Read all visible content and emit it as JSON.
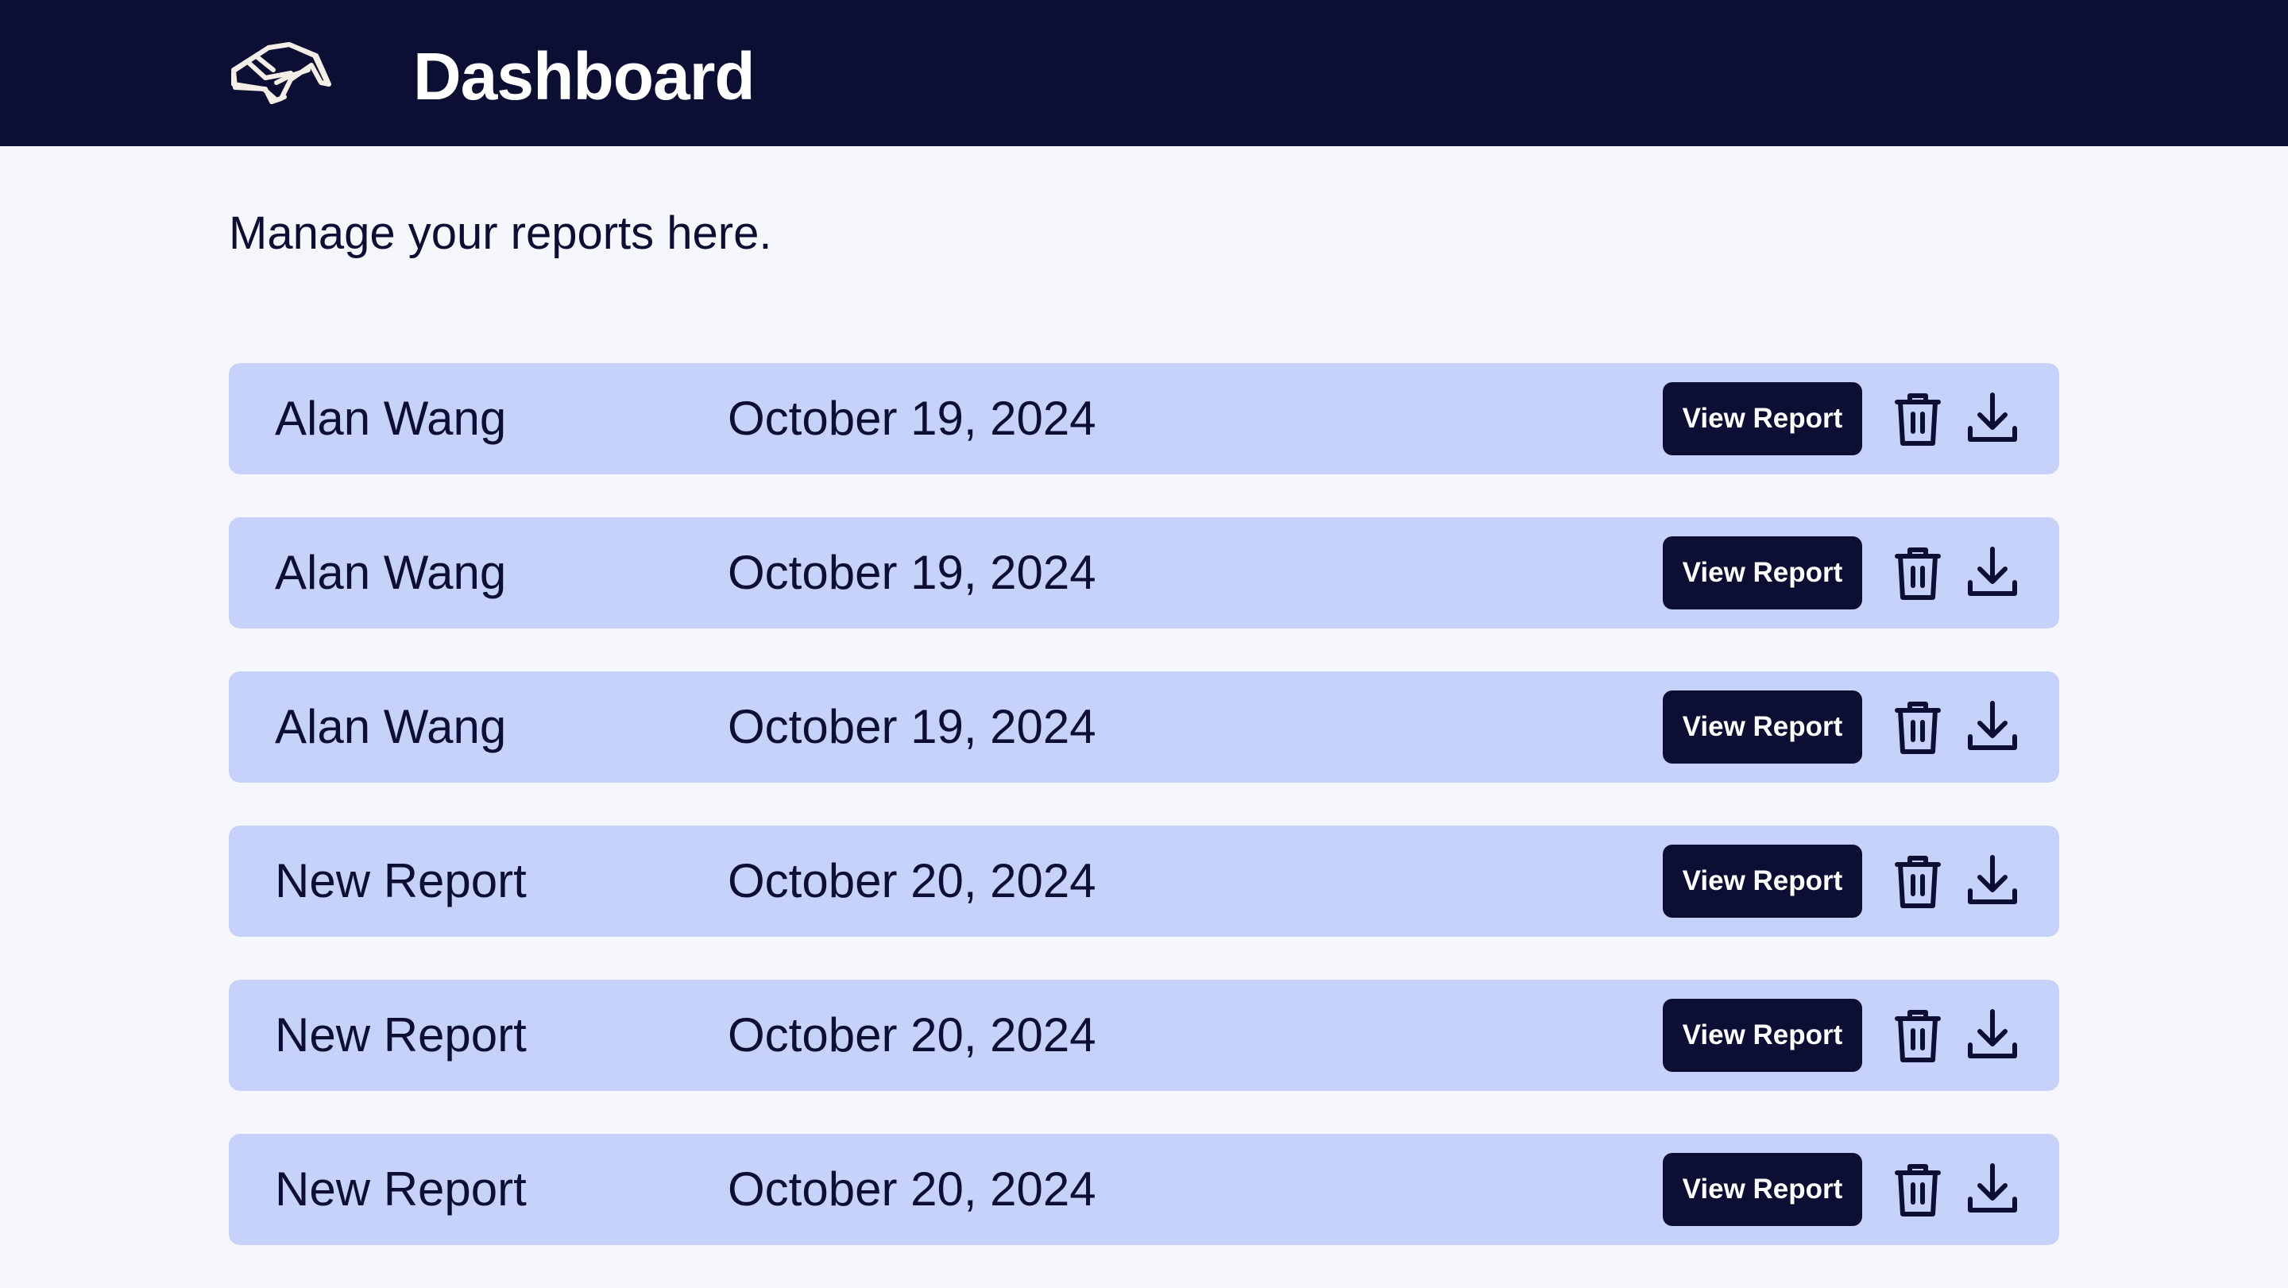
{
  "header": {
    "title": "Dashboard",
    "logo_icon": "hand-logo-icon",
    "background": "#0c0f33"
  },
  "subtitle": "Manage your reports here.",
  "reports": [
    {
      "name": "Alan Wang",
      "date": "October 19, 2024",
      "view_label": "View Report"
    },
    {
      "name": "Alan Wang",
      "date": "October 19, 2024",
      "view_label": "View Report"
    },
    {
      "name": "Alan Wang",
      "date": "October 19, 2024",
      "view_label": "View Report"
    },
    {
      "name": "New Report",
      "date": "October 20, 2024",
      "view_label": "View Report"
    },
    {
      "name": "New Report",
      "date": "October 20, 2024",
      "view_label": "View Report"
    },
    {
      "name": "New Report",
      "date": "October 20, 2024",
      "view_label": "View Report"
    }
  ],
  "icons": {
    "delete": "trash-icon",
    "download": "download-icon"
  },
  "colors": {
    "primary": "#0c0f33",
    "row_background": "#c7d2fa",
    "page_background": "#f6f7fc"
  }
}
